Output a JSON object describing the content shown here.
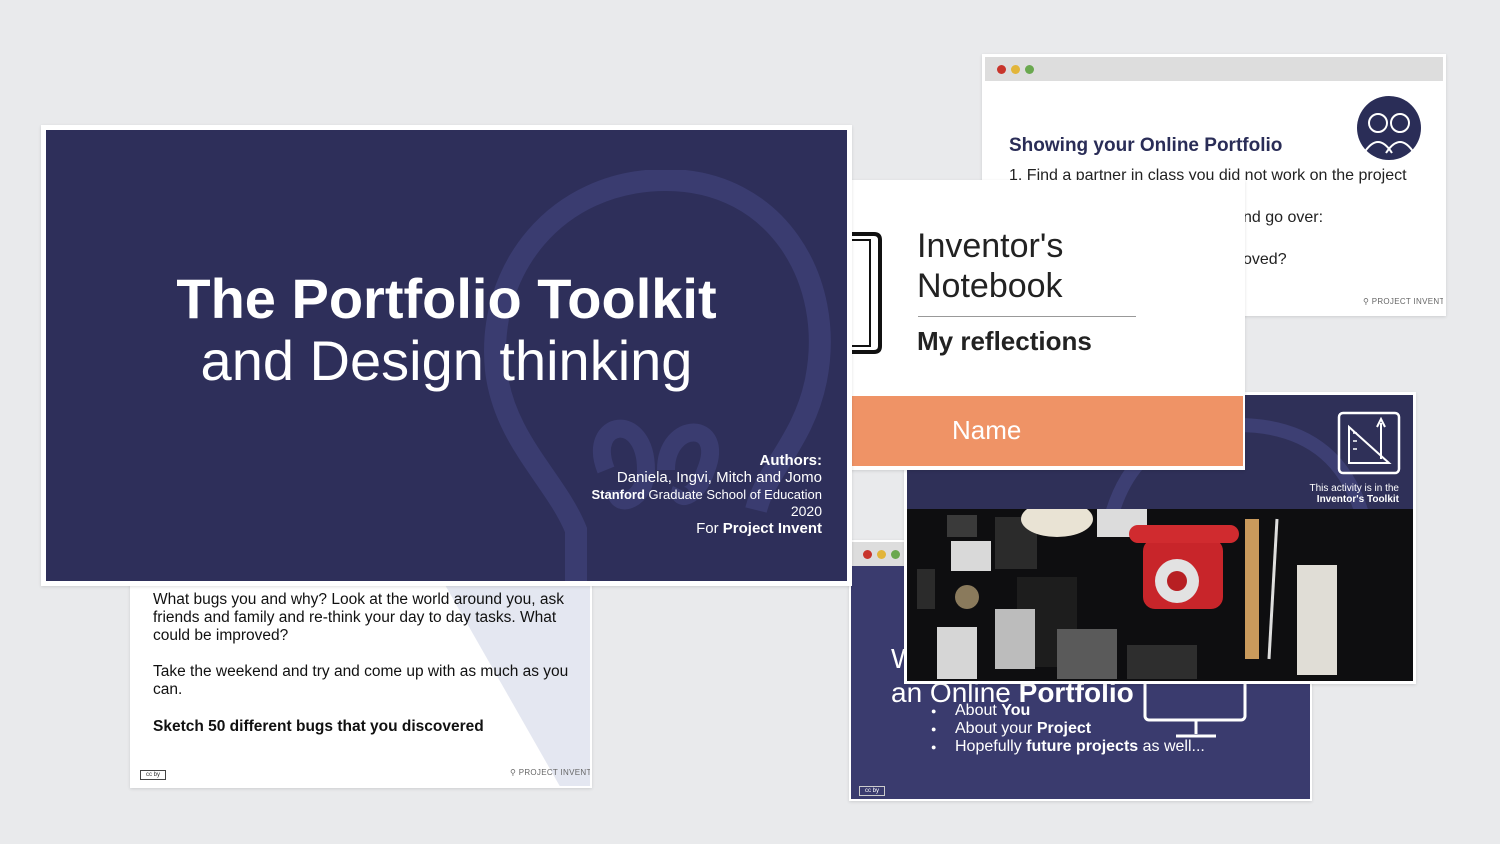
{
  "portfolio_slide": {
    "title": "Showing your Online Portfolio",
    "line1": "1.   Find a partner in class you did not work on the project",
    "line2": "nd go over:",
    "line3": "oved?",
    "logo_text": "PROJECT INVENT"
  },
  "bugs_slide": {
    "para1": "What bugs you and why? Look at the world around you, ask friends and family and re-think your day to day tasks. What could be improved?",
    "para2": "Take the weekend and try and come up with as much as you can.",
    "para3": "Sketch 50 different bugs that you discovered",
    "logo_text": "PROJECT INVENT",
    "license": "cc by"
  },
  "online_slide": {
    "heading_line1": "W",
    "heading_line2_plain": "an Online ",
    "heading_line2_bold": "Portfolio",
    "bullets": [
      {
        "plain_before": "About ",
        "bold": "You",
        "plain_after": ""
      },
      {
        "plain_before": "About your ",
        "bold": "Project",
        "plain_after": ""
      },
      {
        "plain_before": "Hopefully ",
        "bold": "future projects",
        "plain_after": " as well..."
      }
    ],
    "license": "cc by"
  },
  "notebook_slide": {
    "title_line1": "Inventor's",
    "title_line2": "Notebook",
    "subtitle": "My reflections",
    "name_label": "Name",
    "accent_color": "#ef9366"
  },
  "toolkit_slide": {
    "note_line1": "This activity is in the",
    "note_line2": "Inventor's Toolkit"
  },
  "main_slide": {
    "title_bold": "The Portfolio Toolkit",
    "title_regular": "and Design thinking",
    "authors_label": "Authors:",
    "authors_names": "Daniela, Ingvi, Mitch and Jomo",
    "school_bold": "Stanford",
    "school_rest": " Graduate School of Education",
    "year": "2020",
    "for_prefix": "For ",
    "for_bold": "Project Invent",
    "background_color": "#2e2f5a"
  }
}
